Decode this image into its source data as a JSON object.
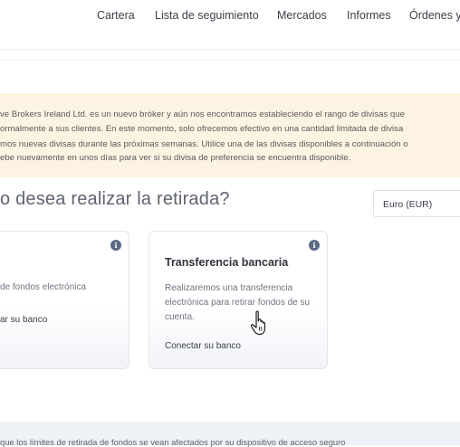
{
  "nav": {
    "items": [
      "Cartera",
      "Lista de seguimiento",
      "Mercados",
      "Informes",
      "Órdenes y"
    ]
  },
  "notice": {
    "lines": [
      "ve Brokers Ireland Ltd. es un nuevo bróker y aún nos encontramos estableciendo el rango de divisas que",
      "ormalmente a sus clientes. En este momento, solo ofrecemos efectivo en una cantidad limitada de divisa",
      "mos nuevas divisas durante las próximas semanas. Utilice una de las divisas disponibles a continuación o",
      "ebe nuevamente en unos días para ver si su divisa de preferencia se encuentra disponible."
    ],
    "background": "#fdf3e3"
  },
  "heading": "o desea realizar la retirada?",
  "currency_select": {
    "value": "Euro (EUR)"
  },
  "cards": {
    "left": {
      "desc": "de fondos electrónica",
      "link": "ar su banco"
    },
    "right": {
      "title": "Transferencia bancaria",
      "desc": "Realizaremos una transferencia electrónica para retirar fondos de su cuenta.",
      "link": "Conectar su banco"
    },
    "info_icon": "i"
  },
  "footer": {
    "text": "que los límites de retirada de fondos se vean afectados por su dispositivo de acceso seguro"
  }
}
